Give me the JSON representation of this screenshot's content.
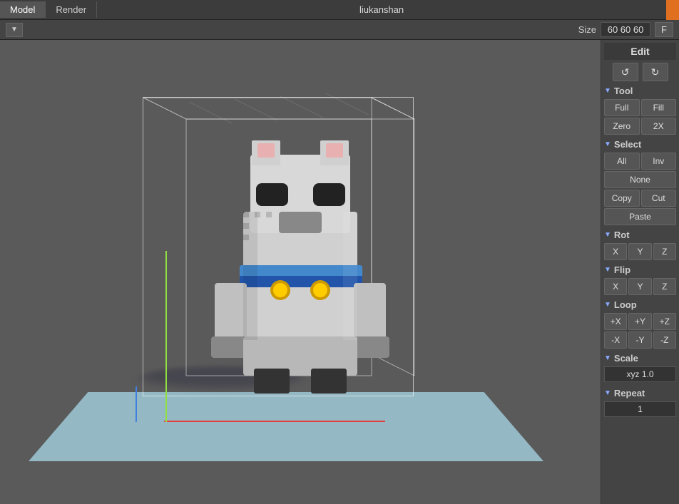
{
  "tabs": [
    {
      "id": "model",
      "label": "Model",
      "active": true
    },
    {
      "id": "render",
      "label": "Render",
      "active": false
    }
  ],
  "title": "liukanshan",
  "size_label": "Size",
  "size_value": "60 60 60",
  "f_button": "F",
  "dropdown_arrow": "▼",
  "right_panel": {
    "edit_header": "Edit",
    "undo_symbol": "↺",
    "redo_symbol": "↻",
    "tool_section": "Tool",
    "tool_buttons": [
      "Full",
      "Fill",
      "Zero",
      "2X"
    ],
    "select_section": "Select",
    "select_buttons_row1": [
      "All",
      "Inv"
    ],
    "select_buttons_row2": [
      "None"
    ],
    "select_buttons_row3": [
      "Copy",
      "Cut"
    ],
    "select_buttons_row4": [
      "Paste"
    ],
    "rot_section": "Rot",
    "rot_buttons": [
      "X",
      "Y",
      "Z"
    ],
    "flip_section": "Flip",
    "flip_buttons": [
      "X",
      "Y",
      "Z"
    ],
    "loop_section": "Loop",
    "loop_buttons_row1": [
      "+X",
      "+Y",
      "+Z"
    ],
    "loop_buttons_row2": [
      "-X",
      "-Y",
      "-Z"
    ],
    "scale_section": "Scale",
    "scale_value": "xyz 1.0",
    "repeat_section": "Repeat",
    "repeat_value": "1"
  }
}
